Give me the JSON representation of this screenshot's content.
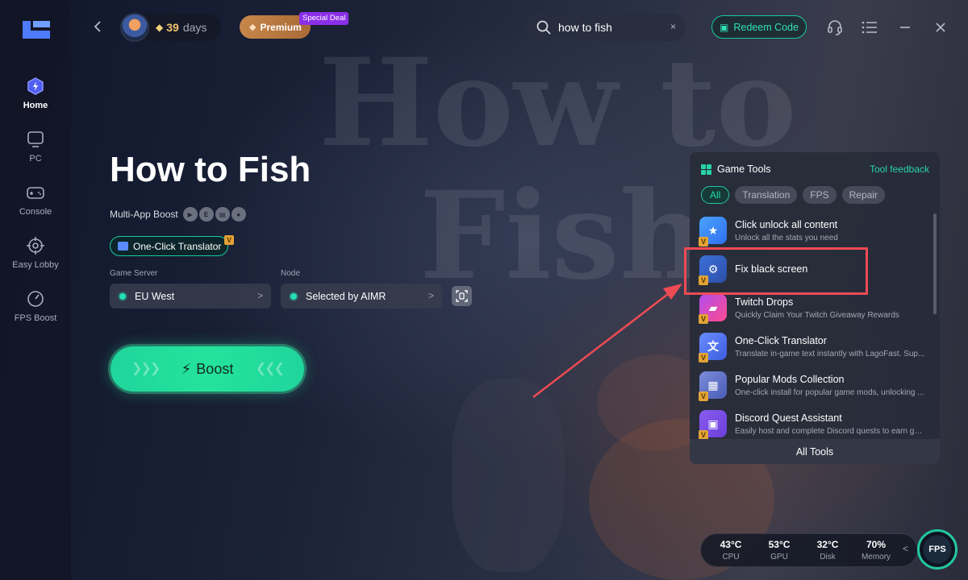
{
  "sidebar": {
    "items": [
      {
        "label": "Home",
        "icon": "home-icon",
        "active": true
      },
      {
        "label": "PC",
        "icon": "pc-icon"
      },
      {
        "label": "Console",
        "icon": "console-icon"
      },
      {
        "label": "Easy Lobby",
        "icon": "lobby-icon"
      },
      {
        "label": "FPS Boost",
        "icon": "fps-boost-icon"
      }
    ]
  },
  "topbar": {
    "days_count": "39",
    "days_label": "days",
    "premium_label": "Premium",
    "special_deal": "Special Deal",
    "search_value": "how to fish",
    "clear_glyph": "×",
    "redeem_label": "Redeem Code"
  },
  "background": {
    "word1": "How to",
    "word2": "Fish"
  },
  "game": {
    "title": "How to Fish",
    "multi_app_label": "Multi-App Boost",
    "translator_label": "One-Click Translator",
    "server_label": "Game Server",
    "server_value": "EU West",
    "node_label": "Node",
    "node_value": "Selected by AIMR",
    "boost_label": "Boost"
  },
  "tools": {
    "title": "Game Tools",
    "feedback_label": "Tool feedback",
    "filters": [
      "All",
      "Translation",
      "FPS",
      "Repair"
    ],
    "active_filter": "All",
    "items": [
      {
        "name": "Click unlock all content",
        "desc": "Unlock all the stats you need",
        "icon": "unlock-icon"
      },
      {
        "name": "Fix black screen",
        "desc": "",
        "icon": "fix-screen-icon"
      },
      {
        "name": "Twitch Drops",
        "desc": "Quickly Claim Your Twitch Giveaway Rewards",
        "icon": "twitch-icon"
      },
      {
        "name": "One-Click Translator",
        "desc": "Translate in-game text instantly with LagoFast. Sup...",
        "icon": "translate-icon"
      },
      {
        "name": "Popular Mods Collection",
        "desc": "One-click install for popular game mods, unlocking ...",
        "icon": "mods-icon"
      },
      {
        "name": "Discord Quest Assistant",
        "desc": "Easily host and complete Discord quests to earn ga...",
        "icon": "discord-gift-icon"
      }
    ],
    "all_tools_label": "All Tools",
    "vip_badge": "V"
  },
  "stats": {
    "cpu": {
      "value": "43°C",
      "label": "CPU"
    },
    "gpu": {
      "value": "53°C",
      "label": "GPU"
    },
    "disk": {
      "value": "32°C",
      "label": "Disk"
    },
    "memory": {
      "value": "70%",
      "label": "Memory"
    },
    "fps_label": "FPS"
  },
  "colors": {
    "accent": "#23d9ab",
    "highlight": "#ef4b54",
    "premium": "#c7874a",
    "special_deal": "#8c2fe8"
  }
}
